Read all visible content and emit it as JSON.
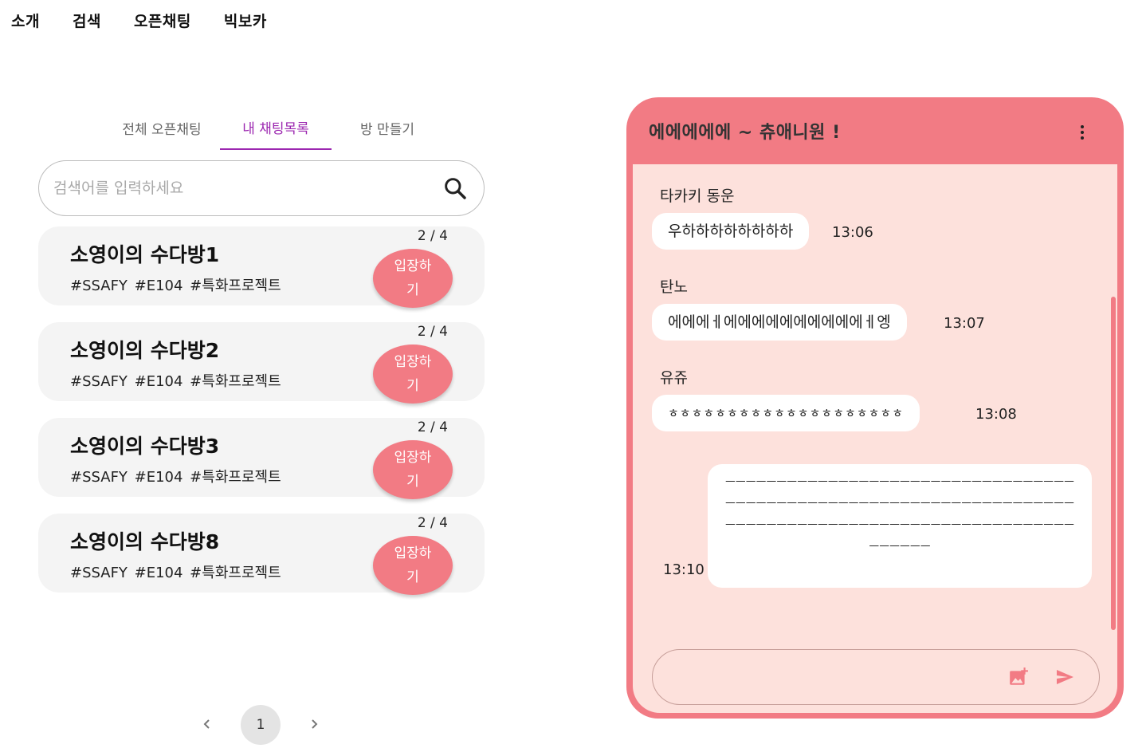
{
  "nav": [
    "소개",
    "검색",
    "오픈채팅",
    "빅보카"
  ],
  "tabs": [
    "전체 오픈채팅",
    "내 채팅목록",
    "방 만들기"
  ],
  "active_tab": "내 채팅목록",
  "search": {
    "placeholder": "검색어를 입력하세요",
    "icon": "search-icon"
  },
  "rooms": [
    {
      "title": "소영이의 수다방1",
      "tags": "#SSAFY #E104 #특화프로젝트",
      "count": "2 / 4",
      "enter": "입장하기"
    },
    {
      "title": "소영이의 수다방2",
      "tags": "#SSAFY #E104 #특화프로젝트",
      "count": "2 / 4",
      "enter": "입장하기"
    },
    {
      "title": "소영이의 수다방3",
      "tags": "#SSAFY #E104 #특화프로젝트",
      "count": "2 / 4",
      "enter": "입장하기"
    },
    {
      "title": "소영이의 수다방8",
      "tags": "#SSAFY #E104 #특화프로젝트",
      "count": "2 / 4",
      "enter": "입장하기"
    }
  ],
  "pagination": {
    "current": "1",
    "prev_icon": "chevron-left-icon",
    "next_icon": "chevron-right-icon"
  },
  "chat": {
    "title": "에에에에에 ~ 츄애니원 !",
    "menu_icon": "more-vertical-icon",
    "messages": [
      {
        "sender": "타카키 동운",
        "text": "우하하하하하하하하",
        "time": "13:06"
      },
      {
        "sender": "탄노",
        "text": "에에에ㅔ에에에에에에에에에에ㅔ엥",
        "time": "13:07"
      },
      {
        "sender": "유쥬",
        "text": "ㅎㅎㅎㅎㅎㅎㅎㅎㅎㅎㅎㅎㅎㅎㅎㅎㅎㅎㅎㅎ",
        "time": "13:08"
      }
    ],
    "my_message": {
      "text": "ㅡㅡㅡㅡㅡㅡㅡㅡㅡㅡㅡㅡㅡㅡㅡㅡㅡㅡㅡㅡㅡㅡㅡㅡㅡㅡㅡㅡㅡㅡㅡㅡㅡㅡㅡㅡㅡㅡㅡㅡㅡㅡㅡㅡㅡㅡㅡㅡㅡㅡㅡㅡㅡㅡㅡㅡㅡㅡㅡㅡㅡㅡㅡㅡㅡㅡㅡㅡㅡㅡㅡㅡㅡㅡㅡㅡㅡㅡㅡㅡㅡㅡㅡㅡㅡㅡㅡㅡㅡㅡㅡㅡㅡㅡㅡㅡㅡㅡㅡㅡㅡㅡㅡㅡㅡㅡㅡㅡ",
      "time": "13:10"
    },
    "input": {
      "placeholder": "",
      "image_icon": "add-photo-icon",
      "send_icon": "send-icon"
    }
  },
  "colors": {
    "accent": "#f27b84",
    "tab_active": "#9c27b0",
    "chat_bg": "#fde1dc",
    "card_bg": "#f4f4f4"
  }
}
